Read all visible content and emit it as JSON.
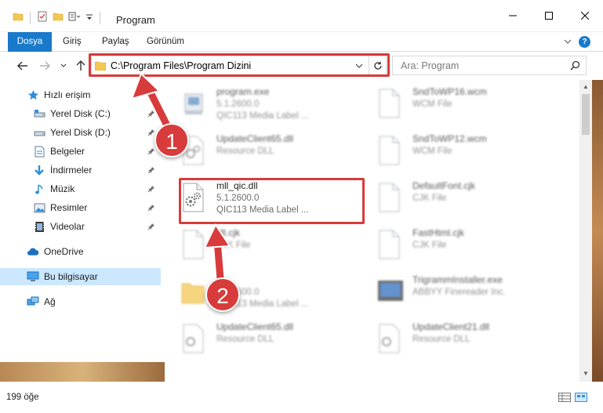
{
  "window": {
    "title": "Program"
  },
  "ribbon": {
    "tabs": [
      "Dosya",
      "Giriş",
      "Paylaş",
      "Görünüm"
    ],
    "help": "?"
  },
  "address_bar": {
    "path": "C:\\Program Files\\Program Dizini"
  },
  "search": {
    "placeholder": "Ara: Program"
  },
  "sidebar": {
    "quick_access": "Hızlı erişim",
    "items": [
      {
        "label": "Yerel Disk (C:)",
        "icon": "drive-icon",
        "pinned": true
      },
      {
        "label": "Yerel Disk (D:)",
        "icon": "drive-icon",
        "pinned": true
      },
      {
        "label": "Belgeler",
        "icon": "documents-icon",
        "pinned": true
      },
      {
        "label": "İndirmeler",
        "icon": "download-icon",
        "pinned": true
      },
      {
        "label": "Müzik",
        "icon": "music-icon",
        "pinned": true
      },
      {
        "label": "Resimler",
        "icon": "pictures-icon",
        "pinned": true
      },
      {
        "label": "Videolar",
        "icon": "videos-icon",
        "pinned": true
      }
    ],
    "onedrive": "OneDrive",
    "this_pc": "Bu bilgisayar",
    "network": "Ağ"
  },
  "files": [
    {
      "name": "program.exe",
      "line2": "5.1.2600.0",
      "line3": "QIC113 Media Label ...",
      "blurred": true
    },
    {
      "name": "SndToWP16.wcm",
      "line2": "WCM File",
      "line3": "",
      "blurred": true
    },
    {
      "name": "UpdateClient65.dll",
      "line2": "Resource DLL",
      "line3": "",
      "blurred": true
    },
    {
      "name": "SndToWP12.wcm",
      "line2": "WCM File",
      "line3": "",
      "blurred": true
    },
    {
      "name": "mll_qic.dll",
      "line2": "5.1.2600.0",
      "line3": "QIC113 Media Label ...",
      "blurred": false
    },
    {
      "name": "DefaultFont.cjk",
      "line2": "CJK File",
      "line3": "",
      "blurred": true
    },
    {
      "name": "dll.cjk",
      "line2": "CJK File",
      "line3": "",
      "blurred": true
    },
    {
      "name": "FastHtml.cjk",
      "line2": "CJK File",
      "line3": "",
      "blurred": true
    },
    {
      "name": "",
      "line2": "5.1.2600.0",
      "line3": "QIC113 Media Label ...",
      "blurred": true
    },
    {
      "name": "TrigrammInstaller.exe",
      "line2": "ABBYY Finereader Inc.",
      "line3": "",
      "blurred": true
    },
    {
      "name": "UpdateClient65.dll",
      "line2": "Resource DLL",
      "line3": "",
      "blurred": true
    },
    {
      "name": "UpdateClient21.dll",
      "line2": "Resource DLL",
      "line3": "",
      "blurred": true
    }
  ],
  "status": {
    "count": "199 öğe"
  },
  "annotations": {
    "step1": "1",
    "step2": "2",
    "color": "#d83b3b"
  }
}
